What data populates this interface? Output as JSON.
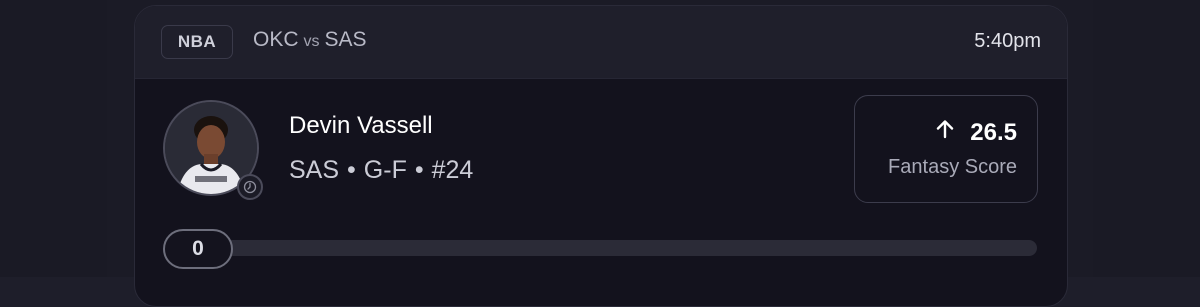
{
  "header": {
    "league": "NBA",
    "team_home": "OKC",
    "vs": "vs",
    "team_away": "SAS",
    "time": "5:40pm"
  },
  "player": {
    "name": "Devin Vassell",
    "team": "SAS",
    "position": "G-F",
    "number": "#24",
    "separator": "•"
  },
  "projection": {
    "direction_icon": "arrow-up-icon",
    "value": "26.5",
    "label": "Fantasy Score"
  },
  "progress": {
    "current_value": "0",
    "fraction": 0
  },
  "colors": {
    "card_bg": "#13121d",
    "header_bg": "#1f1f2b",
    "track": "#2b2b37"
  }
}
